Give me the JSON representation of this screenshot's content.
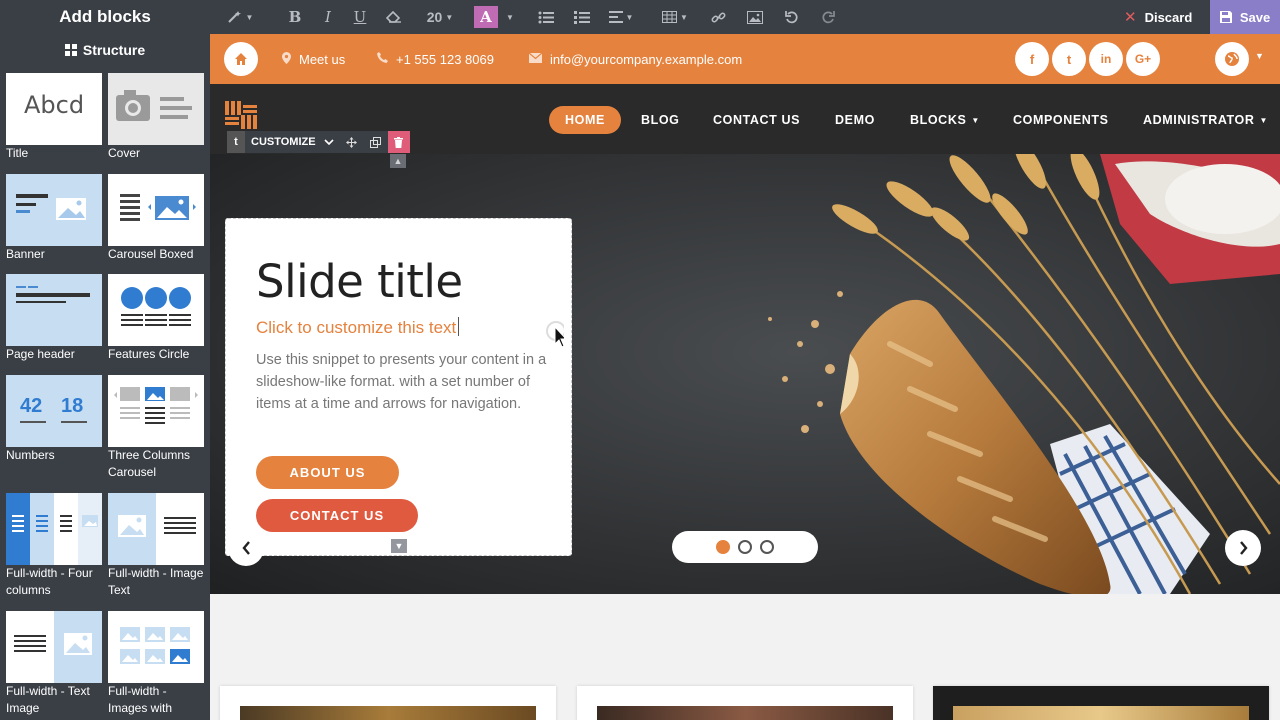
{
  "editor": {
    "title": "Add blocks",
    "font_size": "20",
    "discard_label": "Discard",
    "save_label": "Save"
  },
  "sidebar": {
    "header": "Structure",
    "blocks": [
      {
        "label": "Title",
        "thumb_text": "Abcd"
      },
      {
        "label": "Cover"
      },
      {
        "label": "Banner"
      },
      {
        "label": "Carousel Boxed"
      },
      {
        "label": "Page header"
      },
      {
        "label": "Features Circle"
      },
      {
        "label": "Numbers",
        "thumb_numbers": [
          "42",
          "18"
        ]
      },
      {
        "label": "Three Columns Carousel"
      },
      {
        "label": "Full-width - Four columns"
      },
      {
        "label": "Full-width - Image Text"
      },
      {
        "label": "Full-width - Text Image"
      },
      {
        "label": "Full-width - Images with"
      }
    ]
  },
  "site": {
    "topbar": {
      "location": "Meet us",
      "phone": "+1 555 123 8069",
      "email": "info@yourcompany.example.com",
      "social": [
        "f",
        "t",
        "in",
        "G+"
      ]
    },
    "nav": [
      "HOME",
      "BLOG",
      "CONTACT US",
      "DEMO",
      "BLOCKS",
      "COMPONENTS",
      "ADMINISTRATOR"
    ],
    "customize_label": "CUSTOMIZE",
    "customize_t": "t",
    "slide": {
      "title": "Slide title",
      "subtitle": "Click to customize this text",
      "body": "Use this snippet to presents your content in a slideshow-like format. with a set number of items at a time and arrows for navigation.",
      "about_btn": "ABOUT US",
      "contact_btn": "CONTACT US"
    },
    "carousel": {
      "active_index": 0,
      "count": 3
    }
  },
  "colors": {
    "accent": "#e5823e",
    "editor_bg": "#3a3f46",
    "save": "#8b7ec8",
    "discard_x": "#e05d5d",
    "nav_bg": "#2a2a2a"
  }
}
